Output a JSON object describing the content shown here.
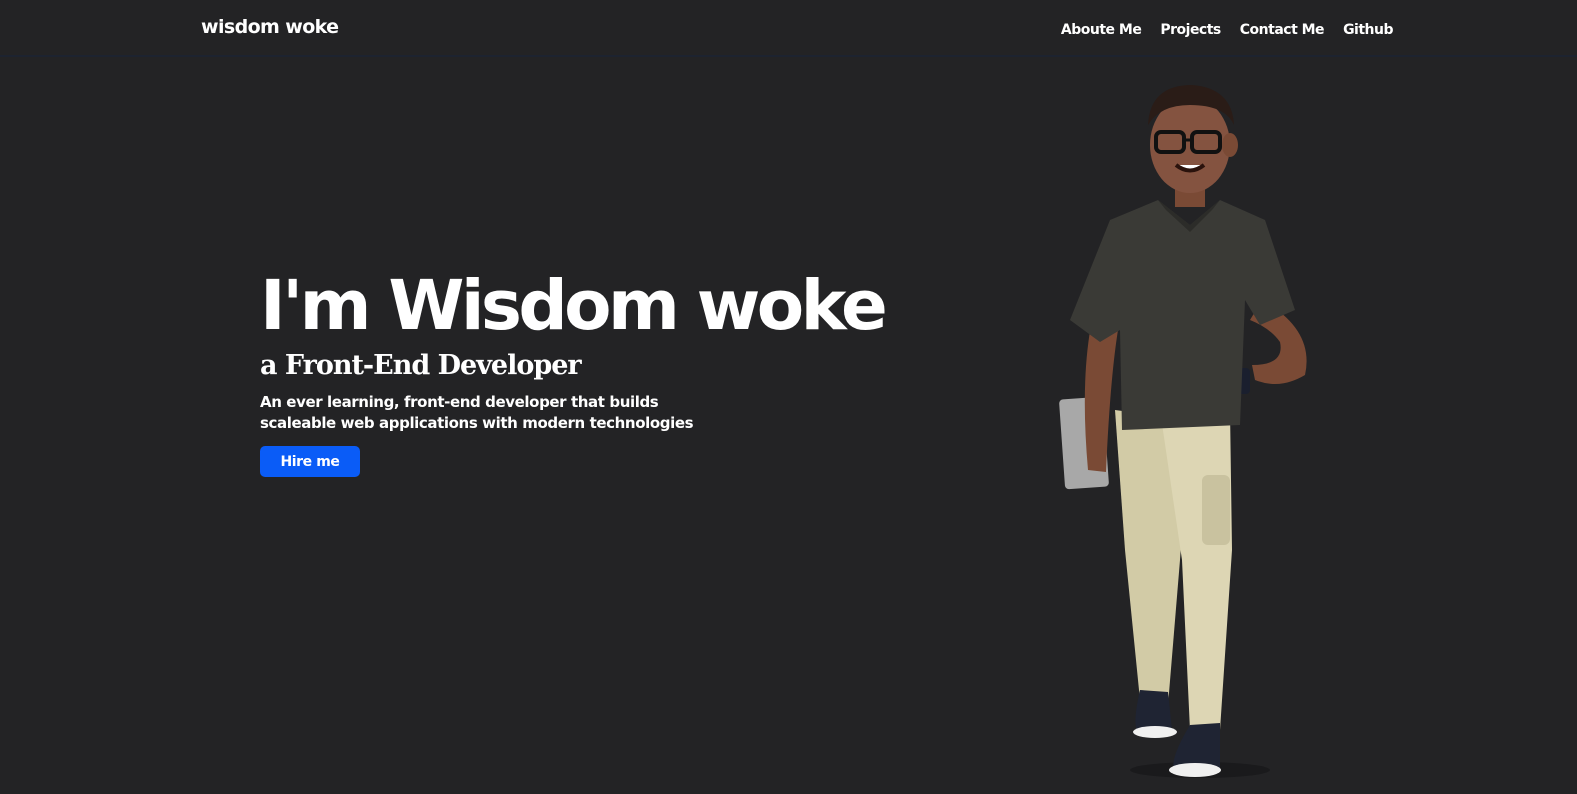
{
  "header": {
    "brand": "wisdom woke",
    "nav": [
      "Aboute Me",
      "Projects",
      "Contact Me",
      "Github"
    ]
  },
  "hero": {
    "title": "I'm Wisdom woke",
    "subtitle": "a Front-End Developer",
    "description": "An ever learning, front-end developer that builds scaleable web applications with modern technologies",
    "cta_label": "Hire me"
  },
  "colors": {
    "background": "#232325",
    "accent": "#0a5cf7",
    "text": "#ffffff"
  },
  "illustration": {
    "icon": "developer-avatar-illustration"
  }
}
